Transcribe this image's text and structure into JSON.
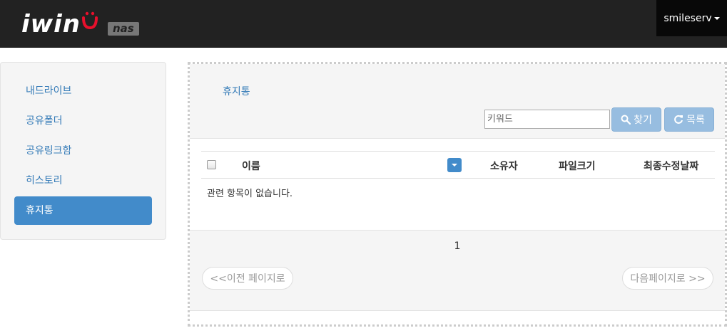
{
  "header": {
    "logo_text": "iwin",
    "logo_badge": "nas",
    "user_label": "smileserv",
    "colors": {
      "bar": "#222222",
      "logo_smile": "#e8102c"
    }
  },
  "sidebar": {
    "items": [
      {
        "label": "내드라이브",
        "active": false
      },
      {
        "label": "공유폴더",
        "active": false
      },
      {
        "label": "공유링크함",
        "active": false
      },
      {
        "label": "히스토리",
        "active": false
      },
      {
        "label": "휴지통",
        "active": true
      }
    ]
  },
  "main": {
    "breadcrumb": "휴지통",
    "search": {
      "placeholder": "키워드",
      "value": ""
    },
    "find_button": {
      "label": "찾기",
      "icon": "search-icon"
    },
    "list_button": {
      "label": "목록",
      "icon": "refresh-icon"
    },
    "table": {
      "columns": [
        "이름",
        "소유자",
        "파일크기",
        "최종수정날짜"
      ],
      "empty_message": "관련 항목이 없습니다."
    },
    "pagination": {
      "current_page": "1",
      "prev_label": "<<이전 페이지로",
      "next_label": "다음페이지로 >>"
    }
  }
}
